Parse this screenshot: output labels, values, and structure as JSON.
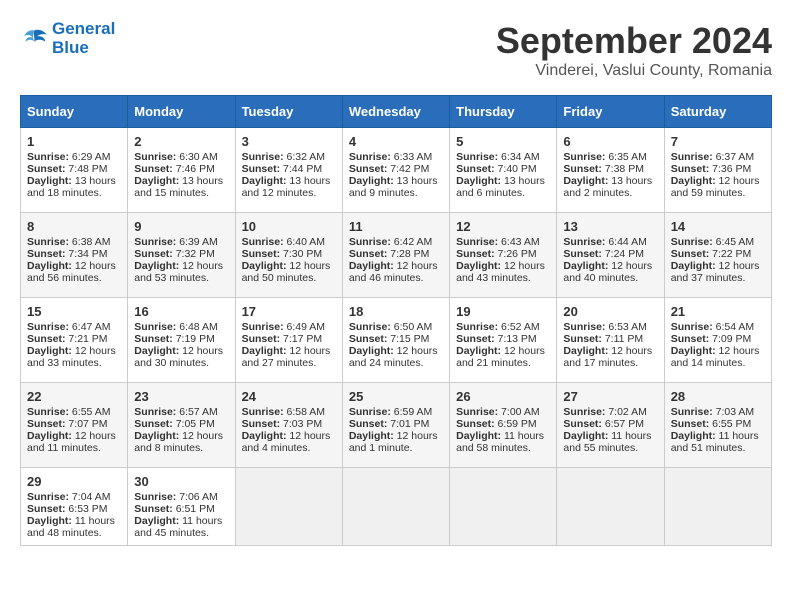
{
  "header": {
    "logo_line1": "General",
    "logo_line2": "Blue",
    "month_title": "September 2024",
    "subtitle": "Vinderei, Vaslui County, Romania"
  },
  "columns": [
    "Sunday",
    "Monday",
    "Tuesday",
    "Wednesday",
    "Thursday",
    "Friday",
    "Saturday"
  ],
  "weeks": [
    [
      {
        "day": "1",
        "info": "Sunrise: 6:29 AM\nSunset: 7:48 PM\nDaylight: 13 hours and 18 minutes."
      },
      {
        "day": "2",
        "info": "Sunrise: 6:30 AM\nSunset: 7:46 PM\nDaylight: 13 hours and 15 minutes."
      },
      {
        "day": "3",
        "info": "Sunrise: 6:32 AM\nSunset: 7:44 PM\nDaylight: 13 hours and 12 minutes."
      },
      {
        "day": "4",
        "info": "Sunrise: 6:33 AM\nSunset: 7:42 PM\nDaylight: 13 hours and 9 minutes."
      },
      {
        "day": "5",
        "info": "Sunrise: 6:34 AM\nSunset: 7:40 PM\nDaylight: 13 hours and 6 minutes."
      },
      {
        "day": "6",
        "info": "Sunrise: 6:35 AM\nSunset: 7:38 PM\nDaylight: 13 hours and 2 minutes."
      },
      {
        "day": "7",
        "info": "Sunrise: 6:37 AM\nSunset: 7:36 PM\nDaylight: 12 hours and 59 minutes."
      }
    ],
    [
      {
        "day": "8",
        "info": "Sunrise: 6:38 AM\nSunset: 7:34 PM\nDaylight: 12 hours and 56 minutes."
      },
      {
        "day": "9",
        "info": "Sunrise: 6:39 AM\nSunset: 7:32 PM\nDaylight: 12 hours and 53 minutes."
      },
      {
        "day": "10",
        "info": "Sunrise: 6:40 AM\nSunset: 7:30 PM\nDaylight: 12 hours and 50 minutes."
      },
      {
        "day": "11",
        "info": "Sunrise: 6:42 AM\nSunset: 7:28 PM\nDaylight: 12 hours and 46 minutes."
      },
      {
        "day": "12",
        "info": "Sunrise: 6:43 AM\nSunset: 7:26 PM\nDaylight: 12 hours and 43 minutes."
      },
      {
        "day": "13",
        "info": "Sunrise: 6:44 AM\nSunset: 7:24 PM\nDaylight: 12 hours and 40 minutes."
      },
      {
        "day": "14",
        "info": "Sunrise: 6:45 AM\nSunset: 7:22 PM\nDaylight: 12 hours and 37 minutes."
      }
    ],
    [
      {
        "day": "15",
        "info": "Sunrise: 6:47 AM\nSunset: 7:21 PM\nDaylight: 12 hours and 33 minutes."
      },
      {
        "day": "16",
        "info": "Sunrise: 6:48 AM\nSunset: 7:19 PM\nDaylight: 12 hours and 30 minutes."
      },
      {
        "day": "17",
        "info": "Sunrise: 6:49 AM\nSunset: 7:17 PM\nDaylight: 12 hours and 27 minutes."
      },
      {
        "day": "18",
        "info": "Sunrise: 6:50 AM\nSunset: 7:15 PM\nDaylight: 12 hours and 24 minutes."
      },
      {
        "day": "19",
        "info": "Sunrise: 6:52 AM\nSunset: 7:13 PM\nDaylight: 12 hours and 21 minutes."
      },
      {
        "day": "20",
        "info": "Sunrise: 6:53 AM\nSunset: 7:11 PM\nDaylight: 12 hours and 17 minutes."
      },
      {
        "day": "21",
        "info": "Sunrise: 6:54 AM\nSunset: 7:09 PM\nDaylight: 12 hours and 14 minutes."
      }
    ],
    [
      {
        "day": "22",
        "info": "Sunrise: 6:55 AM\nSunset: 7:07 PM\nDaylight: 12 hours and 11 minutes."
      },
      {
        "day": "23",
        "info": "Sunrise: 6:57 AM\nSunset: 7:05 PM\nDaylight: 12 hours and 8 minutes."
      },
      {
        "day": "24",
        "info": "Sunrise: 6:58 AM\nSunset: 7:03 PM\nDaylight: 12 hours and 4 minutes."
      },
      {
        "day": "25",
        "info": "Sunrise: 6:59 AM\nSunset: 7:01 PM\nDaylight: 12 hours and 1 minute."
      },
      {
        "day": "26",
        "info": "Sunrise: 7:00 AM\nSunset: 6:59 PM\nDaylight: 11 hours and 58 minutes."
      },
      {
        "day": "27",
        "info": "Sunrise: 7:02 AM\nSunset: 6:57 PM\nDaylight: 11 hours and 55 minutes."
      },
      {
        "day": "28",
        "info": "Sunrise: 7:03 AM\nSunset: 6:55 PM\nDaylight: 11 hours and 51 minutes."
      }
    ],
    [
      {
        "day": "29",
        "info": "Sunrise: 7:04 AM\nSunset: 6:53 PM\nDaylight: 11 hours and 48 minutes."
      },
      {
        "day": "30",
        "info": "Sunrise: 7:06 AM\nSunset: 6:51 PM\nDaylight: 11 hours and 45 minutes."
      },
      {
        "day": "",
        "info": ""
      },
      {
        "day": "",
        "info": ""
      },
      {
        "day": "",
        "info": ""
      },
      {
        "day": "",
        "info": ""
      },
      {
        "day": "",
        "info": ""
      }
    ]
  ]
}
